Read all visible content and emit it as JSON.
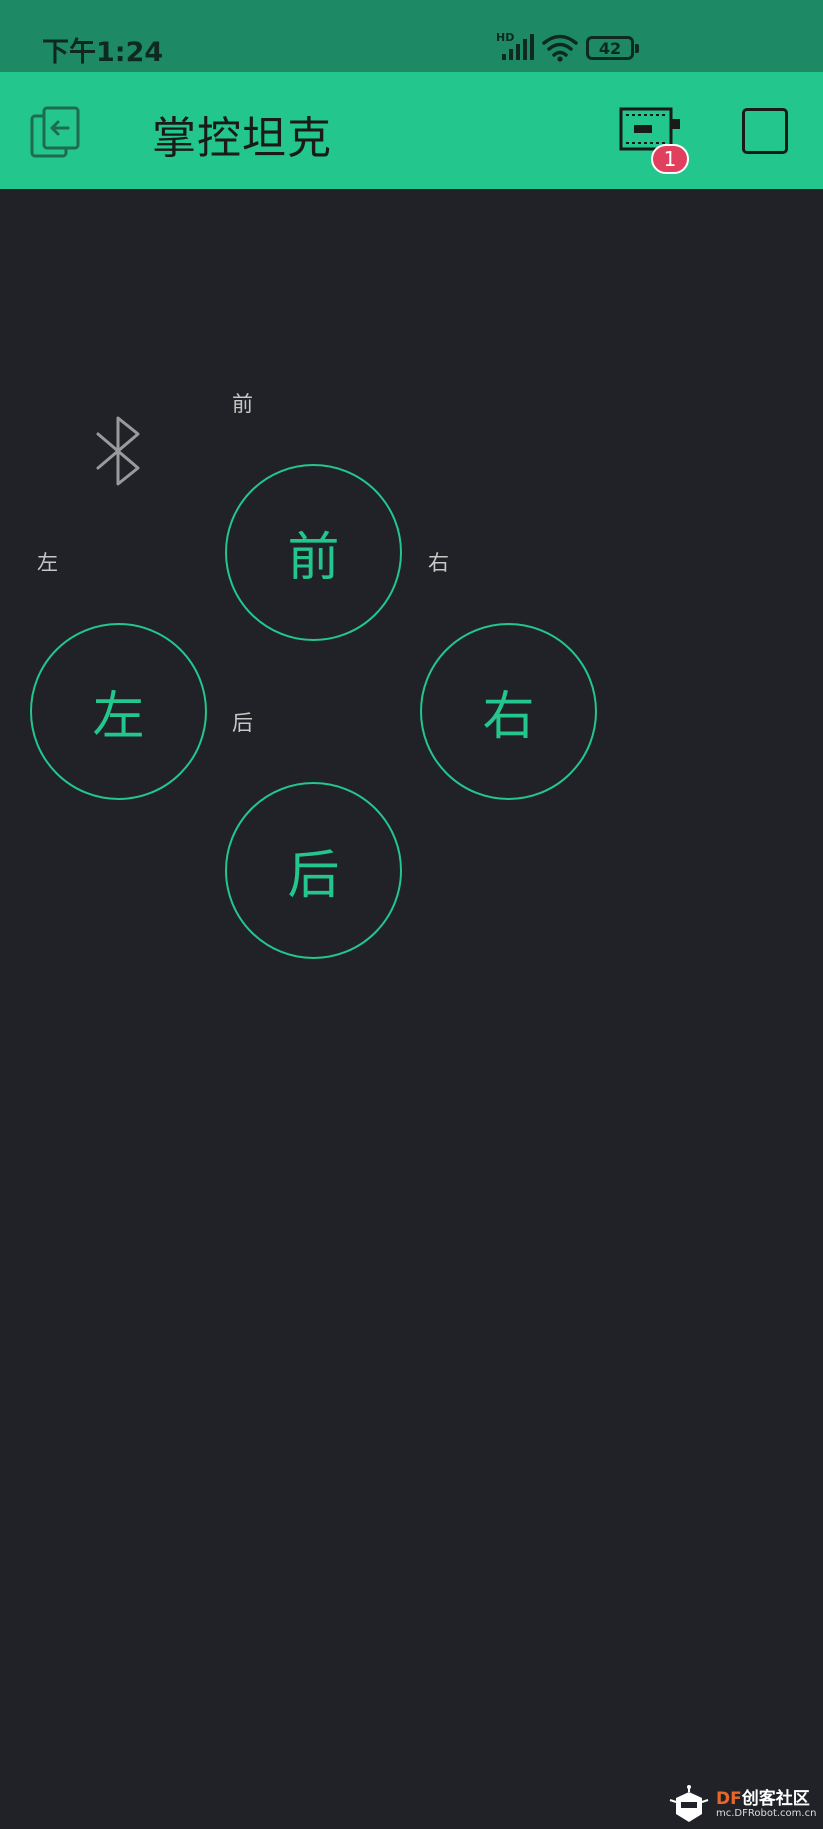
{
  "status_bar": {
    "time": "下午1:24",
    "network_label": "HD",
    "battery_level": "42",
    "icons": [
      "hd-signal-icon",
      "wifi-icon",
      "battery-icon"
    ]
  },
  "app_bar": {
    "title": "掌控坦克",
    "back_icon": "exit-project-icon",
    "device_icon": "device-board-icon",
    "notification_count": "1",
    "stop_icon": "stop-square-icon"
  },
  "controls": {
    "bluetooth_icon": "bluetooth-icon",
    "labels": {
      "forward": "前",
      "left": "左",
      "right": "右",
      "backward": "后"
    },
    "buttons": {
      "forward": "前",
      "left": "左",
      "right": "右",
      "backward": "后"
    }
  },
  "watermark": {
    "brand_prefix": "DF",
    "brand_rest": "创客社区",
    "url": "mc.DFRobot.com.cn"
  },
  "colors": {
    "status_bar": "#1d8a65",
    "app_bar": "#23c68c",
    "background": "#212227",
    "accent": "#23c68c",
    "badge": "#e0405d"
  }
}
